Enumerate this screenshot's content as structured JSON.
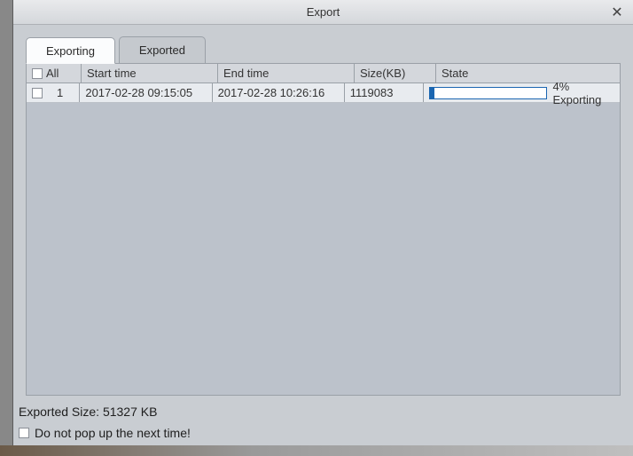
{
  "window": {
    "title": "Export"
  },
  "tabs": {
    "exporting": "Exporting",
    "exported": "Exported"
  },
  "table": {
    "headers": {
      "all": "All",
      "start": "Start time",
      "end": "End time",
      "size": "Size(KB)",
      "state": "State"
    },
    "rows": [
      {
        "idx": "1",
        "start": "2017-02-28 09:15:05",
        "end": "2017-02-28 10:26:16",
        "size": "1119083",
        "progress_pct": 4,
        "state_text": "4% Exporting"
      }
    ]
  },
  "footer": {
    "exported_size": "Exported Size: 51327 KB",
    "checkbox_label": "Do not pop up the next time!"
  }
}
